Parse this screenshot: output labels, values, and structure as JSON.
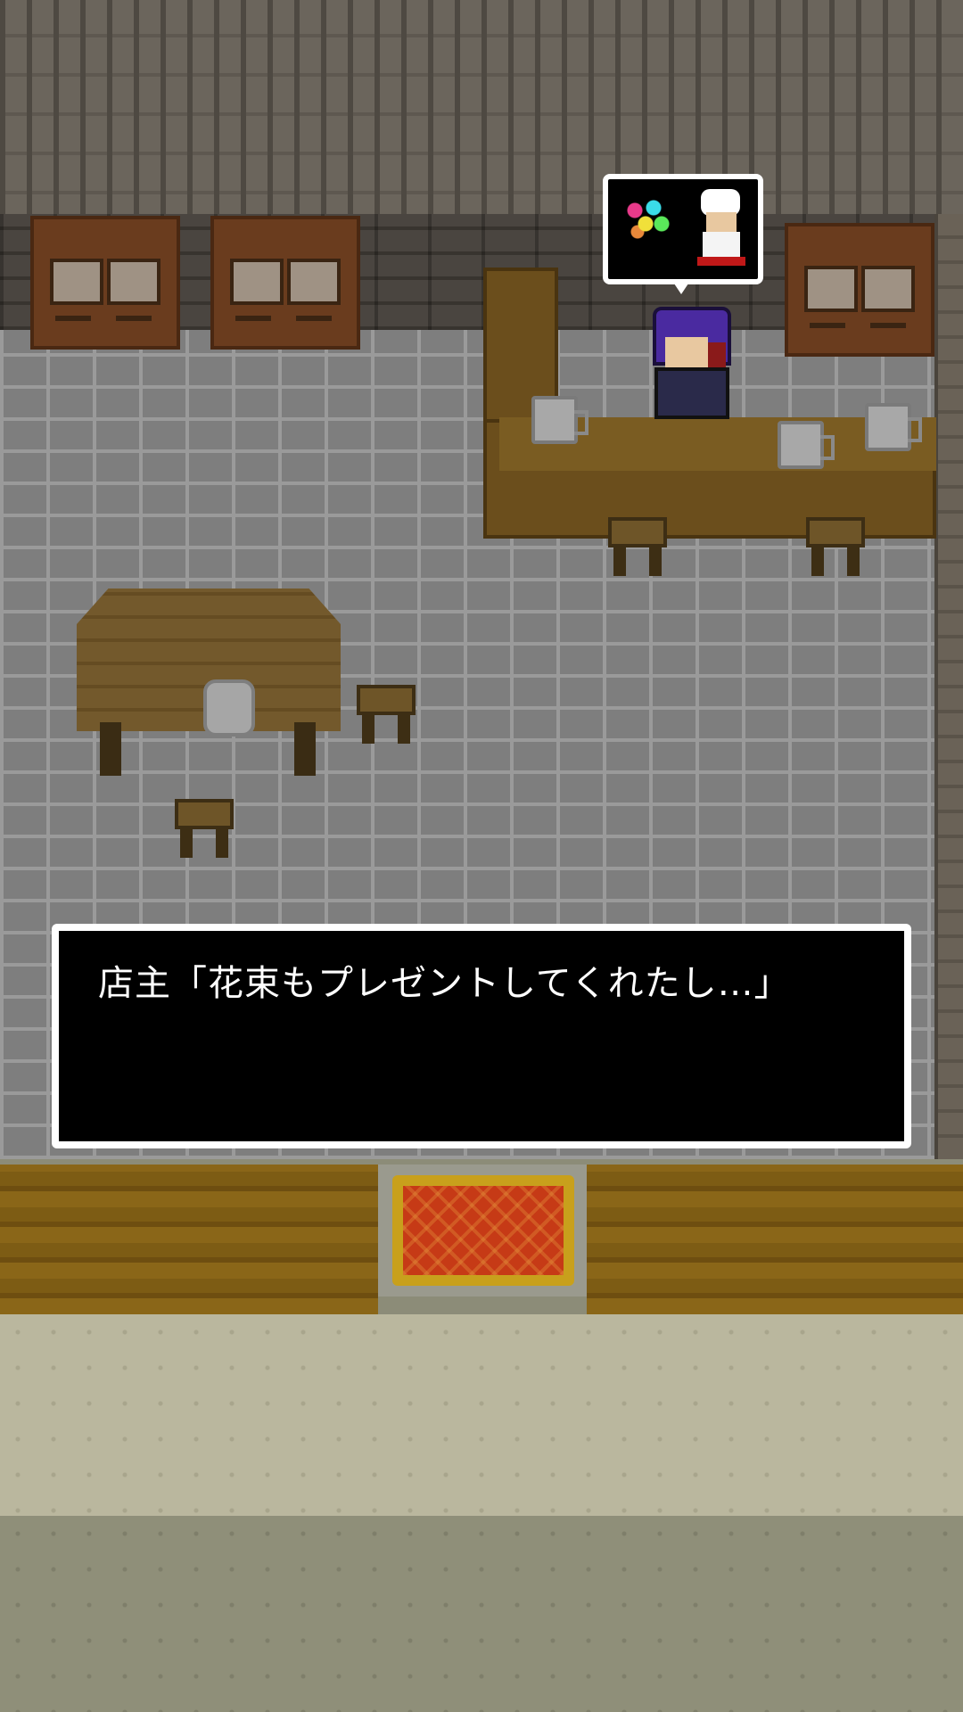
{
  "dialog": {
    "speaker": "店主",
    "text": "店主「花束もプレゼントしてくれたし…」"
  },
  "thought_bubble": {
    "icons": [
      "bouquet-icon",
      "chef-icon"
    ]
  },
  "colors": {
    "dialog_bg": "#000000",
    "dialog_border": "#ffffff",
    "dialog_text": "#ffffff",
    "floor": "#7e7e7e",
    "wood": "#6b4e1c",
    "rug": "#c63a16"
  }
}
